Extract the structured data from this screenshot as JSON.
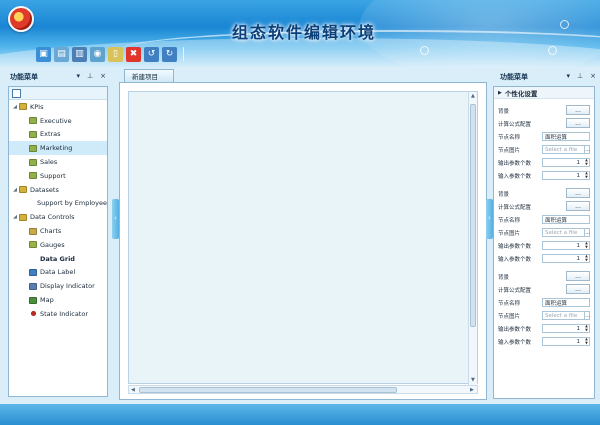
{
  "header": {
    "title": "组态软件编辑环境",
    "toolbar": [
      {
        "icon": "new-icon",
        "color": "#3b8fd6"
      },
      {
        "icon": "open-icon",
        "color": "#6aa8d6"
      },
      {
        "icon": "save-icon",
        "color": "#4c7fb3"
      },
      {
        "icon": "preview-icon",
        "color": "#5ea3cf"
      },
      {
        "icon": "document-icon",
        "color": "#d8c35a"
      },
      {
        "icon": "delete-icon",
        "color": "#e2342a"
      },
      {
        "icon": "undo-icon",
        "color": "#3f7fc2"
      },
      {
        "icon": "redo-icon",
        "color": "#3f7fc2"
      }
    ]
  },
  "left_panel": {
    "title": "功能菜单",
    "controls": [
      "▾",
      "⊥",
      "×"
    ],
    "tree": [
      {
        "label": "KPIs",
        "level": 0,
        "toggle": "◢",
        "icon": "folder-icon",
        "color": "#d4b23a"
      },
      {
        "label": "Executive",
        "level": 1,
        "icon": "gauge-icon",
        "color": "#8fb04a"
      },
      {
        "label": "Extras",
        "level": 1,
        "icon": "gauge-icon",
        "color": "#8fb04a"
      },
      {
        "label": "Marketing",
        "level": 1,
        "icon": "gauge-icon",
        "color": "#8fb04a",
        "selected": true
      },
      {
        "label": "Sales",
        "level": 1,
        "icon": "gauge-icon",
        "color": "#8fb04a"
      },
      {
        "label": "Support",
        "level": 1,
        "icon": "gauge-icon",
        "color": "#8fb04a"
      },
      {
        "label": "Datasets",
        "level": 0,
        "toggle": "◢",
        "icon": "folder-icon",
        "color": "#d4b23a"
      },
      {
        "label": "Support by Employee",
        "level": 1,
        "icon": "",
        "color": ""
      },
      {
        "label": "Data Controls",
        "level": 0,
        "toggle": "◢",
        "icon": "folder-icon",
        "color": "#d4b23a"
      },
      {
        "label": "Charts",
        "level": 1,
        "icon": "chart-icon",
        "color": "#c9a94a"
      },
      {
        "label": "Gauges",
        "level": 1,
        "icon": "gauge-icon",
        "color": "#9ab24a"
      },
      {
        "label": "Data Grid",
        "level": 1,
        "icon": "",
        "color": "",
        "bold": true
      },
      {
        "label": "Data Label",
        "level": 1,
        "icon": "label-icon",
        "color": "#3f7fc2"
      },
      {
        "label": "Display Indicator",
        "level": 1,
        "icon": "indicator-icon",
        "color": "#5a7fb0"
      },
      {
        "label": "Map",
        "level": 1,
        "icon": "map-icon",
        "color": "#4a8f3a"
      },
      {
        "label": "State Indicator",
        "level": 1,
        "icon": "state-icon",
        "color": "#cc2a1c"
      }
    ]
  },
  "center": {
    "tab_label": "新建项目"
  },
  "right_panel": {
    "title": "功能菜单",
    "controls": [
      "▾",
      "⊥",
      "×"
    ],
    "section_title": "个性化设置",
    "groups": [
      {
        "background_label": "背景",
        "background_btn": "...",
        "formula_label": "计算公式配置",
        "formula_btn": "...",
        "node_name_label": "节点名称",
        "node_name_value": "面积运算",
        "node_image_label": "节点图片",
        "node_image_placeholder": "Select a file",
        "node_image_btn": "...",
        "output_label": "输出参数个数",
        "output_value": "1",
        "input_label": "输入参数个数",
        "input_value": "1"
      },
      {
        "background_label": "背景",
        "background_btn": "...",
        "formula_label": "计算公式配置",
        "formula_btn": "...",
        "node_name_label": "节点名称",
        "node_name_value": "面积运算",
        "node_image_label": "节点图片",
        "node_image_placeholder": "Select a file",
        "node_image_btn": "...",
        "output_label": "输出参数个数",
        "output_value": "1",
        "input_label": "输入参数个数",
        "input_value": "1"
      },
      {
        "background_label": "背景",
        "background_btn": "...",
        "formula_label": "计算公式配置",
        "formula_btn": "...",
        "node_name_label": "节点名称",
        "node_name_value": "面积运算",
        "node_image_label": "节点图片",
        "node_image_placeholder": "Select a file",
        "node_image_btn": "...",
        "output_label": "输出参数个数",
        "output_value": "1",
        "input_label": "输入参数个数",
        "input_value": "1"
      }
    ]
  }
}
